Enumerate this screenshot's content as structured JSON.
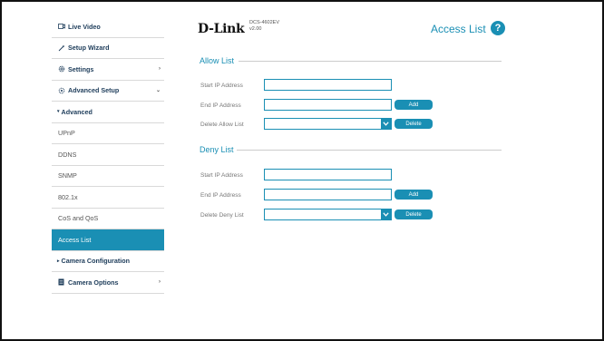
{
  "sidebar": {
    "items": [
      {
        "label": "Live Video"
      },
      {
        "label": "Setup Wizard"
      },
      {
        "label": "Settings"
      },
      {
        "label": "Advanced Setup"
      },
      {
        "label": "Advanced"
      },
      {
        "label": "UPnP"
      },
      {
        "label": "DDNS"
      },
      {
        "label": "SNMP"
      },
      {
        "label": "802.1x"
      },
      {
        "label": "CoS and QoS"
      },
      {
        "label": "Access List"
      },
      {
        "label": "Camera Configuration"
      },
      {
        "label": "Camera Options"
      }
    ],
    "arrows": {
      "settings": "›",
      "advanced_setup": "⌄",
      "camera_options": "›"
    },
    "bullets": {
      "advanced": "▾",
      "camera_configuration": "▸"
    }
  },
  "header": {
    "logo": "D-Link",
    "model": "DCS-4602EV",
    "version": "v2.00",
    "title": "Access List",
    "help_icon_text": "?"
  },
  "allow_list": {
    "title": "Allow List",
    "start_label": "Start IP Address",
    "start_value": "",
    "end_label": "End IP Address",
    "end_value": "",
    "add_button": "Add",
    "delete_label": "Delete Allow List",
    "delete_selected": "",
    "delete_button": "Delete"
  },
  "deny_list": {
    "title": "Deny List",
    "start_label": "Start IP Address",
    "start_value": "",
    "end_label": "End IP Address",
    "end_value": "",
    "add_button": "Add",
    "delete_label": "Delete Deny List",
    "delete_selected": "",
    "delete_button": "Delete"
  },
  "colors": {
    "accent": "#1a8fb4",
    "active_nav": "#1a8fb4",
    "frame": "#111111"
  }
}
